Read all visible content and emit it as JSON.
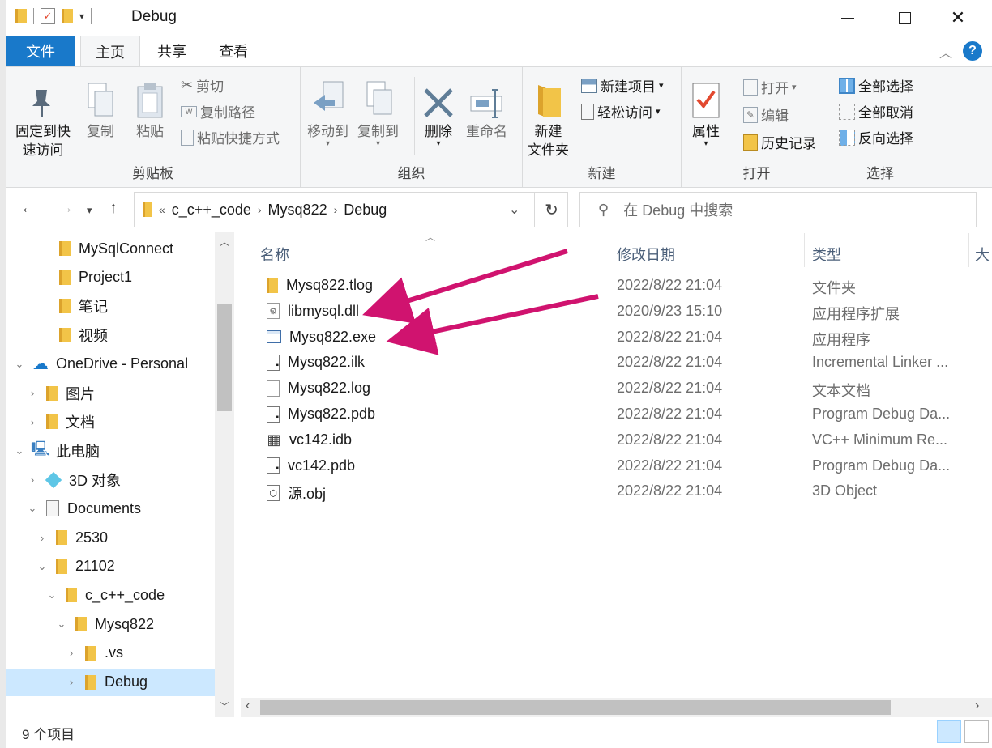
{
  "window": {
    "title": "Debug",
    "controls": {
      "minimize": "minimize-icon",
      "maximize": "maximize-icon",
      "close": "close-icon"
    }
  },
  "ribbon_tabs": {
    "file": "文件",
    "home": "主页",
    "share": "共享",
    "view": "查看"
  },
  "ribbon": {
    "clipboard": {
      "label": "剪贴板",
      "pin_line1": "固定到快",
      "pin_line2": "速访问",
      "copy": "复制",
      "paste": "粘贴",
      "cut": "剪切",
      "copy_path": "复制路径",
      "paste_shortcut": "粘贴快捷方式"
    },
    "organize": {
      "label": "组织",
      "move_to": "移动到",
      "copy_to": "复制到",
      "delete": "删除",
      "rename": "重命名"
    },
    "new": {
      "label": "新建",
      "new_folder_line1": "新建",
      "new_folder_line2": "文件夹",
      "new_item": "新建项目",
      "easy_access": "轻松访问"
    },
    "open": {
      "label": "打开",
      "properties": "属性",
      "open": "打开",
      "edit": "编辑",
      "history": "历史记录"
    },
    "select": {
      "label": "选择",
      "select_all": "全部选择",
      "select_none": "全部取消",
      "invert": "反向选择"
    }
  },
  "address": {
    "overflow": "«",
    "crumbs": [
      "c_c++_code",
      "Mysq822",
      "Debug"
    ],
    "search_placeholder": "在 Debug 中搜索"
  },
  "nav_tree": [
    {
      "label": "MySqlConnect",
      "icon": "folder-icon",
      "arrow": ""
    },
    {
      "label": "Project1",
      "icon": "folder-icon",
      "arrow": ""
    },
    {
      "label": "笔记",
      "icon": "folder-icon",
      "arrow": ""
    },
    {
      "label": "视频",
      "icon": "folder-icon",
      "arrow": ""
    },
    {
      "label": "OneDrive - Personal",
      "icon": "onedrive-icon",
      "arrow": "expanded"
    },
    {
      "label": "图片",
      "icon": "folder-icon",
      "arrow": "collapsed"
    },
    {
      "label": "文档",
      "icon": "folder-icon",
      "arrow": "collapsed"
    },
    {
      "label": "此电脑",
      "icon": "computer-icon",
      "arrow": "expanded"
    },
    {
      "label": "3D 对象",
      "icon": "3d-objects-icon",
      "arrow": "collapsed"
    },
    {
      "label": "Documents",
      "icon": "documents-icon",
      "arrow": "expanded"
    },
    {
      "label": "2530",
      "icon": "folder-icon",
      "arrow": "collapsed"
    },
    {
      "label": "21102",
      "icon": "folder-icon",
      "arrow": "expanded"
    },
    {
      "label": "c_c++_code",
      "icon": "folder-icon",
      "arrow": "expanded"
    },
    {
      "label": "Mysq822",
      "icon": "folder-icon",
      "arrow": "expanded"
    },
    {
      "label": ".vs",
      "icon": "folder-icon",
      "arrow": "collapsed"
    },
    {
      "label": "Debug",
      "icon": "folder-icon",
      "arrow": "collapsed",
      "selected": true
    }
  ],
  "columns": {
    "name": "名称",
    "date": "修改日期",
    "type": "类型",
    "size": "大"
  },
  "files": [
    {
      "name": "Mysq822.tlog",
      "date": "2022/8/22 21:04",
      "type": "文件夹",
      "icon": "folder-icon"
    },
    {
      "name": "libmysql.dll",
      "date": "2020/9/23 15:10",
      "type": "应用程序扩展",
      "icon": "dll-icon"
    },
    {
      "name": "Mysq822.exe",
      "date": "2022/8/22 21:04",
      "type": "应用程序",
      "icon": "exe-icon"
    },
    {
      "name": "Mysq822.ilk",
      "date": "2022/8/22 21:04",
      "type": "Incremental Linker ...",
      "icon": "ilk-file-icon"
    },
    {
      "name": "Mysq822.log",
      "date": "2022/8/22 21:04",
      "type": "文本文档",
      "icon": "text-file-icon"
    },
    {
      "name": "Mysq822.pdb",
      "date": "2022/8/22 21:04",
      "type": "Program Debug Da...",
      "icon": "pdb-file-icon"
    },
    {
      "name": "vc142.idb",
      "date": "2022/8/22 21:04",
      "type": "VC++ Minimum Re...",
      "icon": "idb-file-icon"
    },
    {
      "name": "vc142.pdb",
      "date": "2022/8/22 21:04",
      "type": "Program Debug Da...",
      "icon": "pdb-file-icon"
    },
    {
      "name": "源.obj",
      "date": "2022/8/22 21:04",
      "type": "3D Object",
      "icon": "obj-file-icon"
    }
  ],
  "status": {
    "item_count": "9 个项目"
  },
  "colors": {
    "file_tab": "#1979ca",
    "selection": "#cce8ff",
    "annotation_arrow": "#d0136f",
    "folder": "#f2c448"
  }
}
